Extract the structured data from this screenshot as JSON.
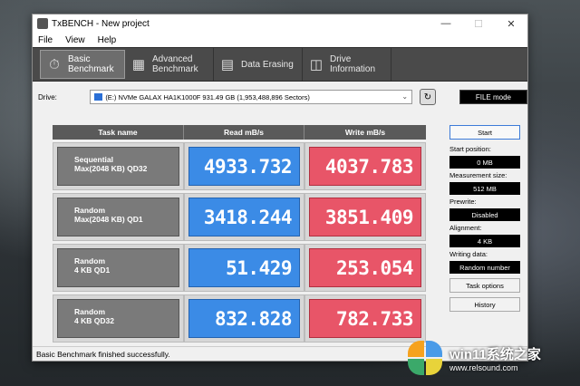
{
  "window": {
    "title": "TxBENCH - New project"
  },
  "menu": [
    "File",
    "View",
    "Help"
  ],
  "tabs": [
    {
      "line1": "Basic",
      "line2": "Benchmark",
      "icon": "stopwatch-icon"
    },
    {
      "line1": "Advanced",
      "line2": "Benchmark",
      "icon": "bar-chart-icon"
    },
    {
      "line1": "Data Erasing",
      "line2": "",
      "icon": "eraser-icon"
    },
    {
      "line1": "Drive",
      "line2": "Information",
      "icon": "drive-icon"
    }
  ],
  "drive": {
    "label": "Drive:",
    "value": "(E:) NVMe GALAX HA1K1000F  931.49 GB (1,953,488,896 Sectors)",
    "mode": "FILE mode"
  },
  "table": {
    "headers": [
      "Task name",
      "Read mB/s",
      "Write mB/s"
    ],
    "rows": [
      {
        "line1": "Sequential",
        "line2": "Max(2048 KB) QD32",
        "read": "4933.732",
        "write": "4037.783"
      },
      {
        "line1": "Random",
        "line2": "Max(2048 KB) QD1",
        "read": "3418.244",
        "write": "3851.409"
      },
      {
        "line1": "Random",
        "line2": "4 KB QD1",
        "read": "51.429",
        "write": "253.054"
      },
      {
        "line1": "Random",
        "line2": "4 KB QD32",
        "read": "832.828",
        "write": "782.733"
      }
    ]
  },
  "side": {
    "start": "Start",
    "start_position_label": "Start position:",
    "start_position": "0 MB",
    "measurement_size_label": "Measurement size:",
    "measurement_size": "512 MB",
    "prewrite_label": "Prewrite:",
    "prewrite": "Disabled",
    "alignment_label": "Alignment:",
    "alignment": "4 KB",
    "writing_data_label": "Writing data:",
    "writing_data": "Random number",
    "task_options": "Task options",
    "history": "History"
  },
  "status": "Basic Benchmark finished successfully.",
  "watermark": {
    "line1": "win11系统之家",
    "line2": "www.relsound.com"
  }
}
